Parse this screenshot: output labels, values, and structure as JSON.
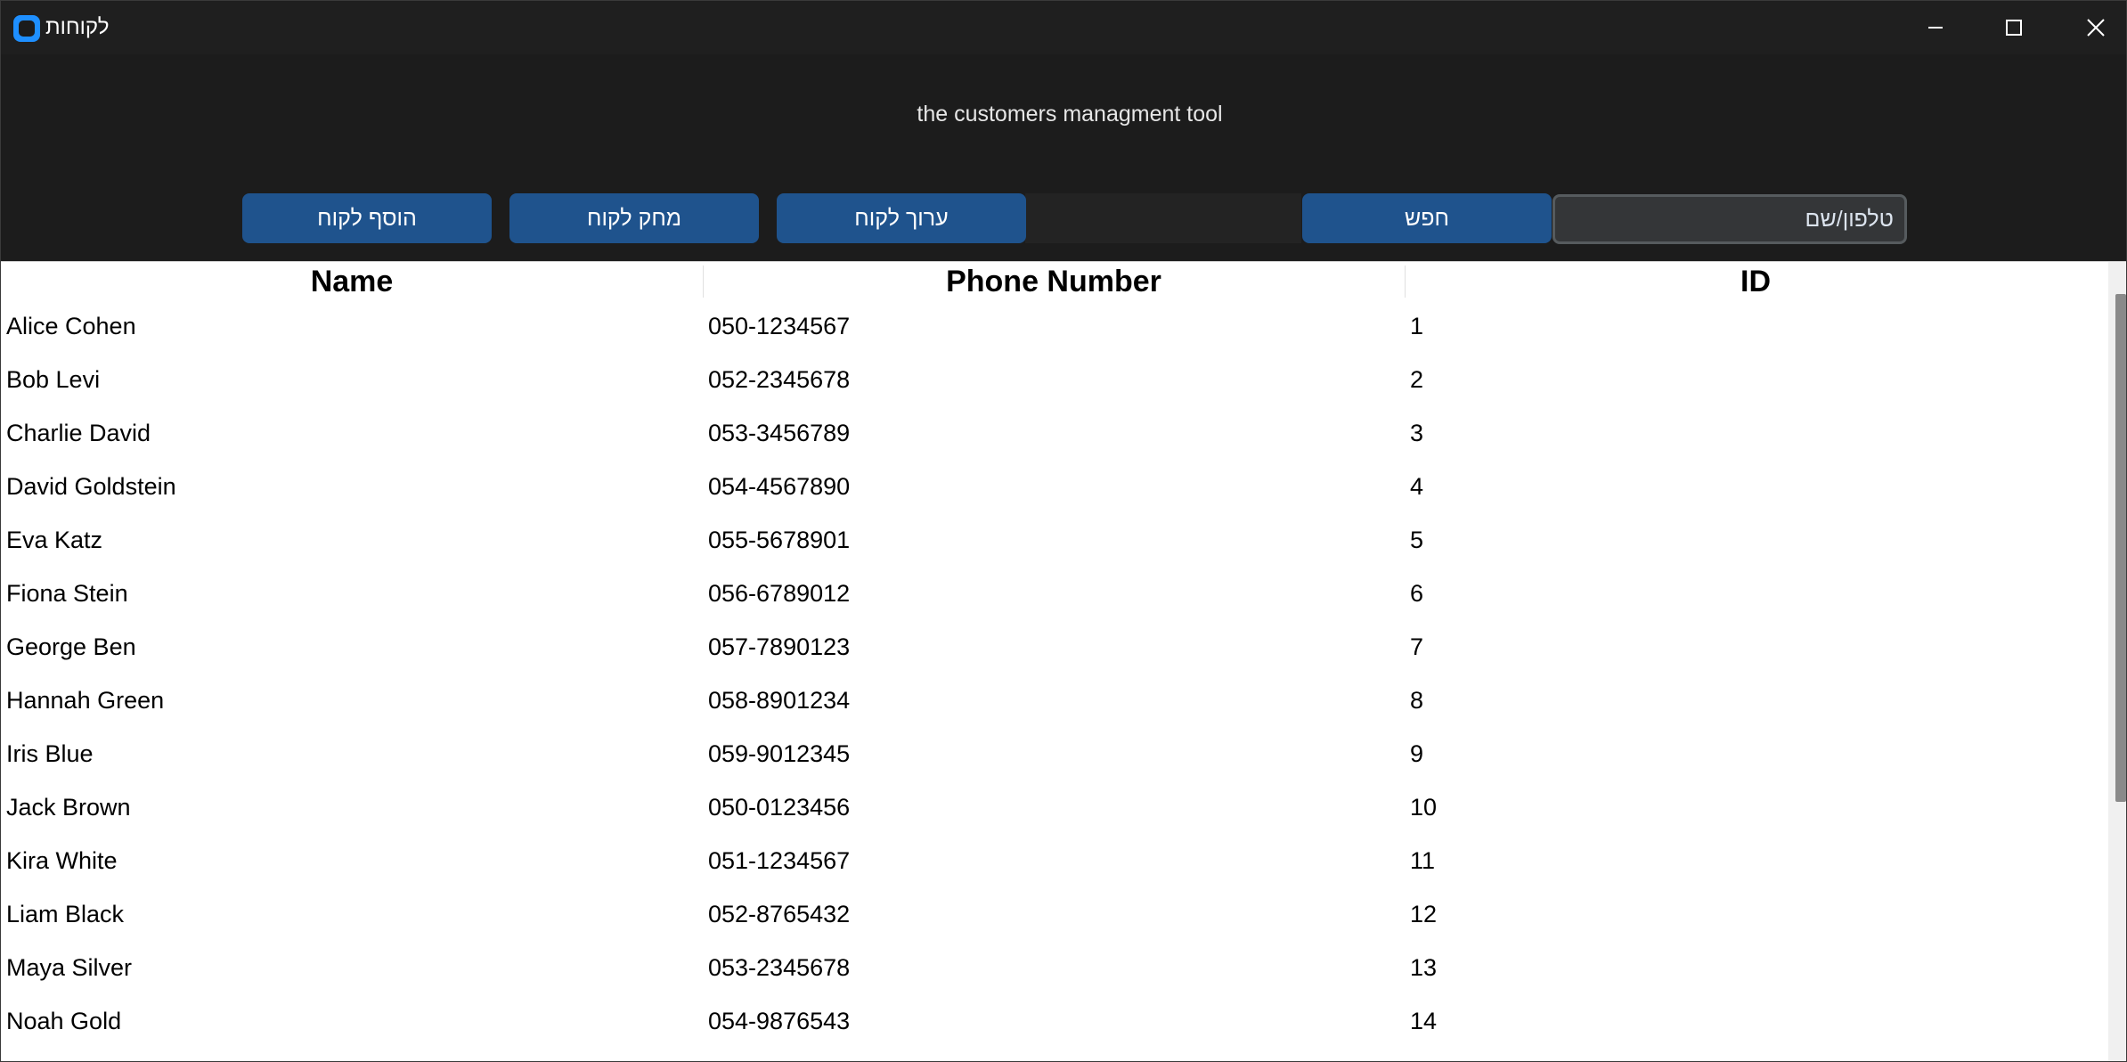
{
  "window": {
    "title": "לקוחות",
    "subtitle": "the customers managment tool",
    "controls": {
      "minimize": "minimize-icon",
      "maximize": "maximize-icon",
      "close": "close-icon"
    }
  },
  "toolbar": {
    "add_label": "הוסף לקוח",
    "delete_label": "מחק לקוח",
    "edit_label": "ערוך לקוח",
    "search_label": "חפש",
    "search_value": "טלפון/שם"
  },
  "colors": {
    "background": "#1c1c1c",
    "button": "#1f538d",
    "input": "#343638",
    "table": "#ffffff",
    "accent_icon": "#1e8fff"
  },
  "table": {
    "columns": [
      "Name",
      "Phone Number",
      "ID"
    ],
    "rows": [
      [
        "Alice Cohen",
        "050-1234567",
        "1"
      ],
      [
        "Bob Levi",
        "052-2345678",
        "2"
      ],
      [
        "Charlie David",
        "053-3456789",
        "3"
      ],
      [
        "David Goldstein",
        "054-4567890",
        "4"
      ],
      [
        "Eva Katz",
        "055-5678901",
        "5"
      ],
      [
        "Fiona Stein",
        "056-6789012",
        "6"
      ],
      [
        "George Ben",
        "057-7890123",
        "7"
      ],
      [
        "Hannah Green",
        "058-8901234",
        "8"
      ],
      [
        "Iris Blue",
        "059-9012345",
        "9"
      ],
      [
        "Jack Brown",
        "050-0123456",
        "10"
      ],
      [
        "Kira White",
        "051-1234567",
        "11"
      ],
      [
        "Liam Black",
        "052-8765432",
        "12"
      ],
      [
        "Maya Silver",
        "053-2345678",
        "13"
      ],
      [
        "Noah Gold",
        "054-9876543",
        "14"
      ]
    ]
  }
}
